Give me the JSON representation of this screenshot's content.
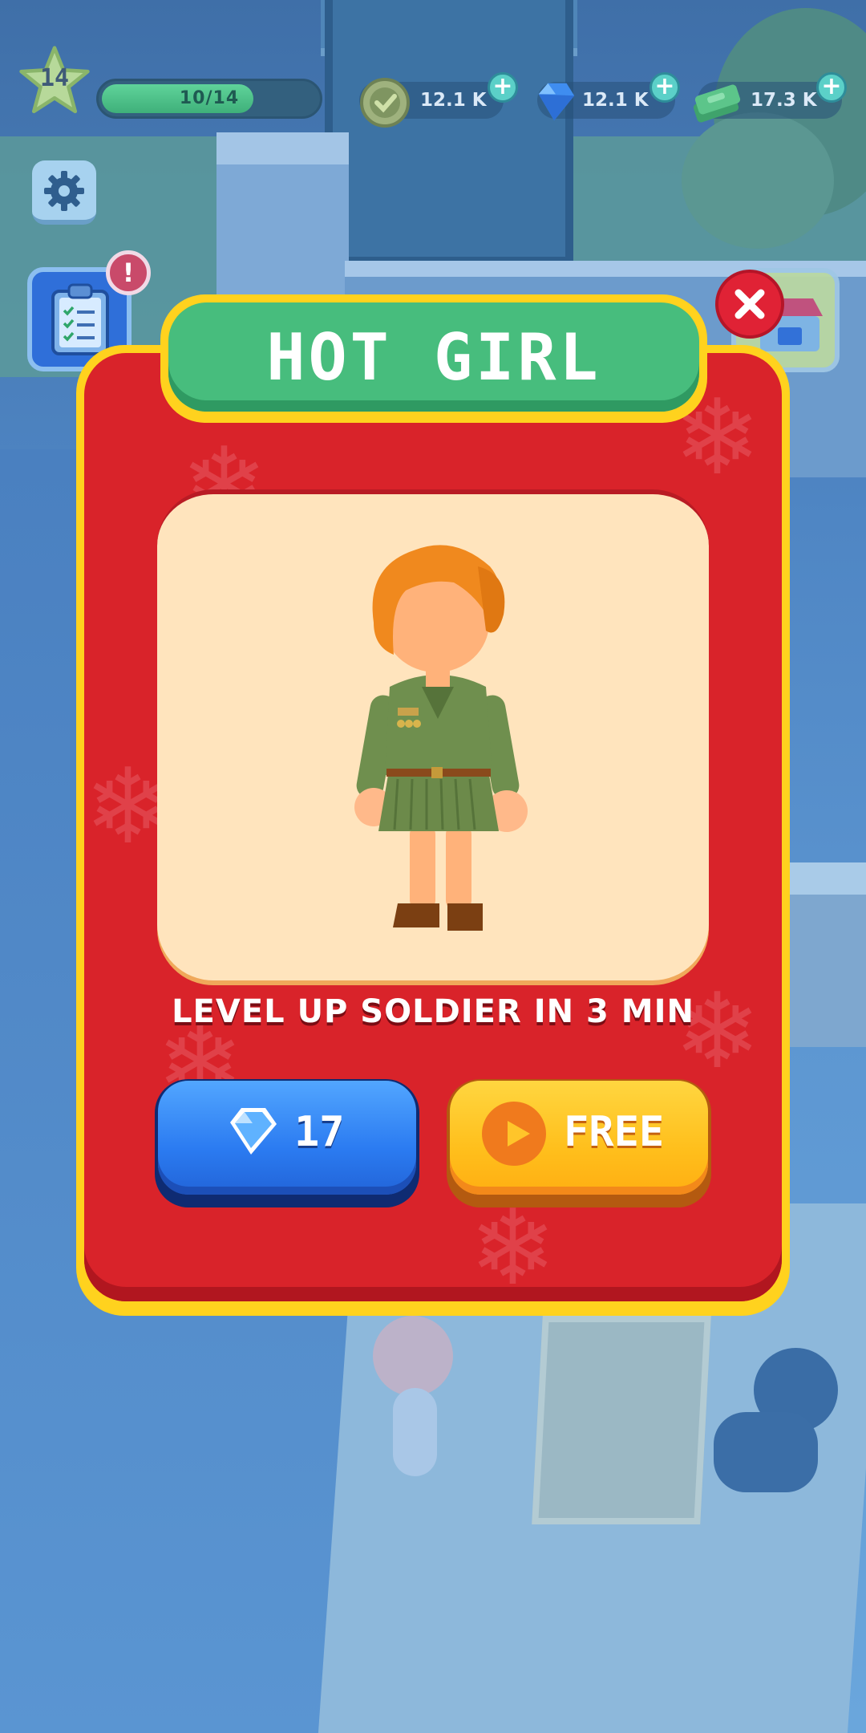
{
  "hud": {
    "level": "14",
    "xp_text": "10/14",
    "xp_progress": 0.714,
    "currencies": [
      {
        "name": "tokens",
        "amount": "12.1 K",
        "icon": "medal-coin-icon"
      },
      {
        "name": "gems",
        "amount": "12.1 K",
        "icon": "gem-icon"
      },
      {
        "name": "cash",
        "amount": "17.3 K",
        "icon": "cash-stack-icon"
      }
    ],
    "alert_badge": "!"
  },
  "modal": {
    "title": "HOT GIRL",
    "subtitle": "LEVEL UP SOLDIER IN 3 MIN",
    "gem_price": "17",
    "free_label": "FREE"
  },
  "colors": {
    "modal_red": "#d9232a",
    "modal_border": "#ffd21e",
    "title_green": "#47bd7d",
    "gem_button_blue": "#2b7bf1",
    "free_button_yellow": "#ffbf1c",
    "close_red": "#e02235"
  }
}
